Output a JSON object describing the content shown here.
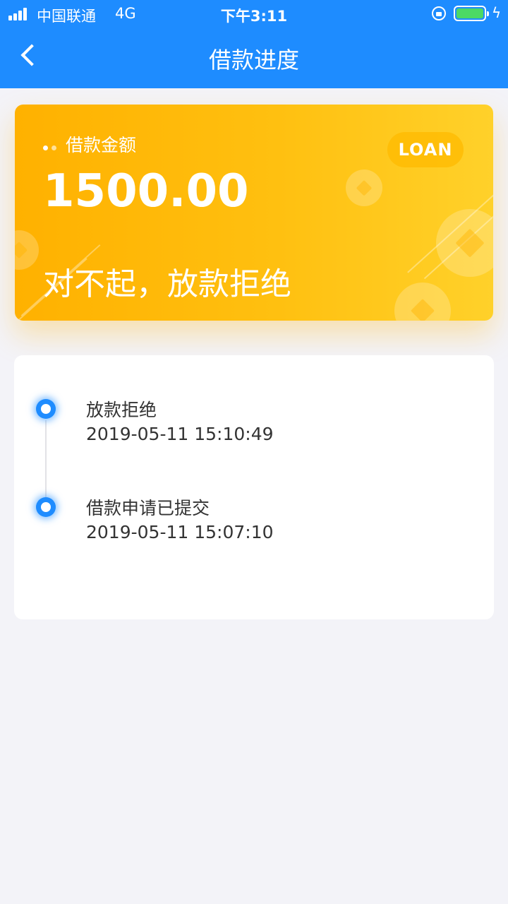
{
  "status_bar": {
    "carrier": "中国联通",
    "network": "4G",
    "time": "下午3:11",
    "battery_level": 1.0,
    "charging": true
  },
  "nav": {
    "title": "借款进度",
    "back_icon": "chevron-left-icon"
  },
  "loan_card": {
    "label": "借款金额",
    "badge": "LOAN",
    "amount": "1500.00",
    "status": "对不起，放款拒绝"
  },
  "timeline": {
    "items": [
      {
        "title": "放款拒绝",
        "time": "2019-05-11 15:10:49"
      },
      {
        "title": "借款申请已提交",
        "time": "2019-05-11 15:07:10"
      }
    ]
  },
  "colors": {
    "header": "#1e8cff",
    "card_start": "#ffb100",
    "card_end": "#ffd12a",
    "background": "#f3f3f8"
  }
}
